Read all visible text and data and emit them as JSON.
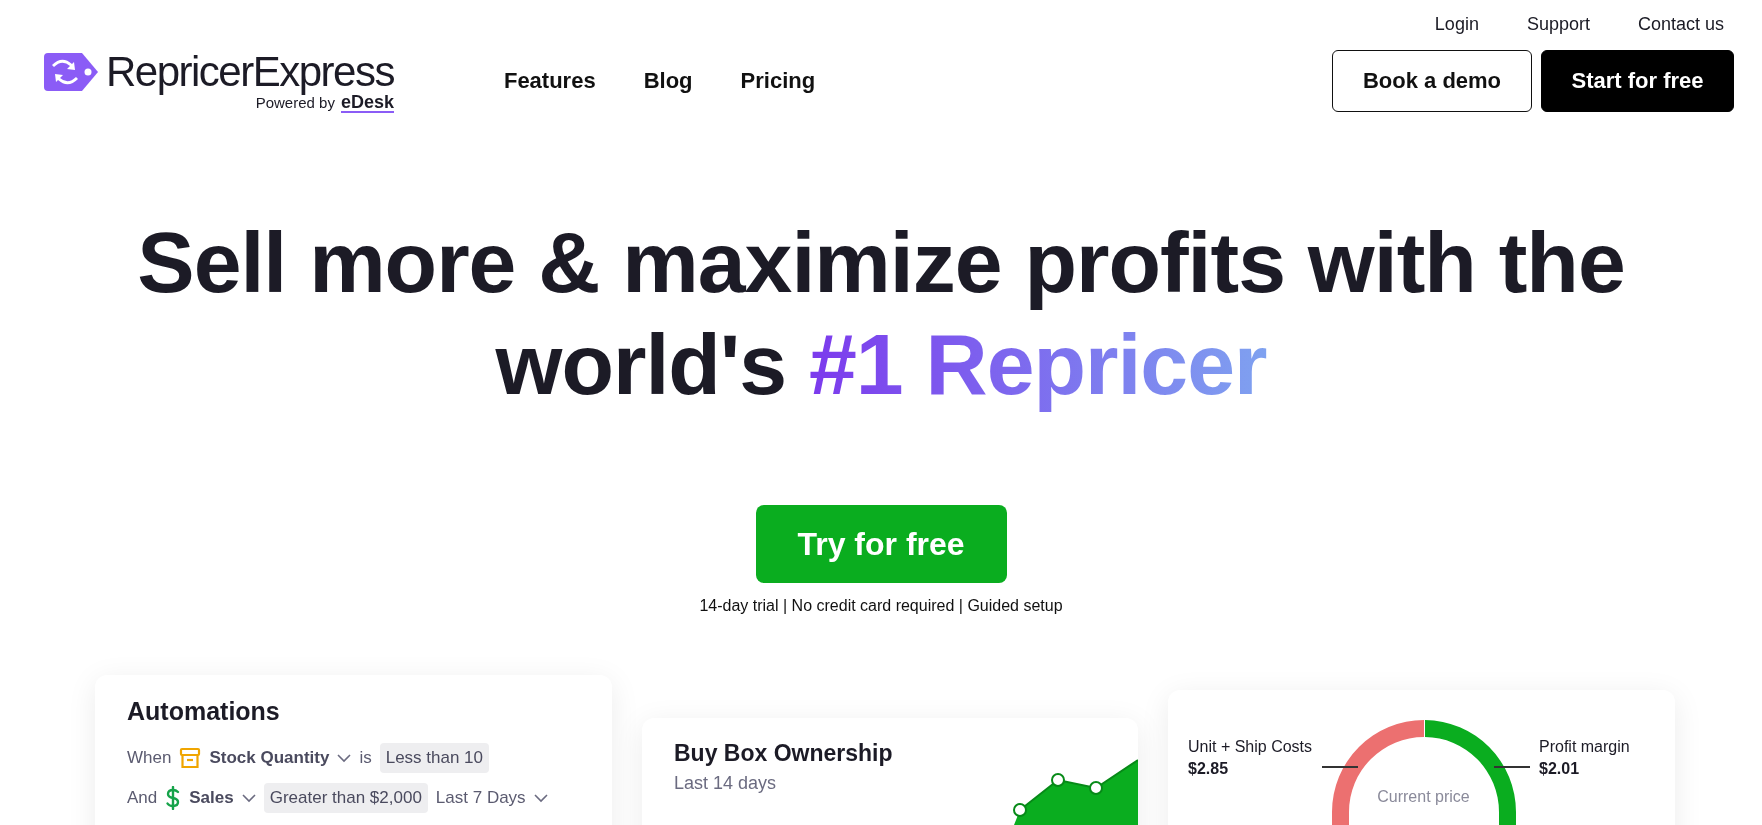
{
  "top_links": [
    "Login",
    "Support",
    "Contact us"
  ],
  "logo": {
    "name": "RepricerExpress",
    "powered_by": "Powered by",
    "partner": "eDesk"
  },
  "nav": [
    "Features",
    "Blog",
    "Pricing"
  ],
  "header_buttons": [
    {
      "label": "Book a demo",
      "kind": "outline"
    },
    {
      "label": "Start for free",
      "kind": "solid"
    }
  ],
  "hero": {
    "headline": "Sell more & maximize profits with the world's",
    "highlight": "#1 Repricer",
    "cta": "Try for free",
    "note": "14-day trial | No credit card required | Guided setup"
  },
  "automations": {
    "title": "Automations",
    "rows": [
      {
        "lead": "When",
        "kind": "box",
        "field": "Stock Quantity",
        "verb": "is",
        "condition": "Less than 10"
      },
      {
        "lead": "And",
        "kind": "dollar",
        "field": "Sales",
        "condition": "Greater than $2,000",
        "period": "Last 7 Days"
      }
    ]
  },
  "buy_box": {
    "title": "Buy Box Ownership",
    "subtitle": "Last 14 days"
  },
  "price_gauge": {
    "left_label": "Unit + Ship Costs",
    "left_value": "$2.85",
    "right_label": "Profit margin",
    "right_value": "$2.01",
    "center_label": "Current price"
  }
}
